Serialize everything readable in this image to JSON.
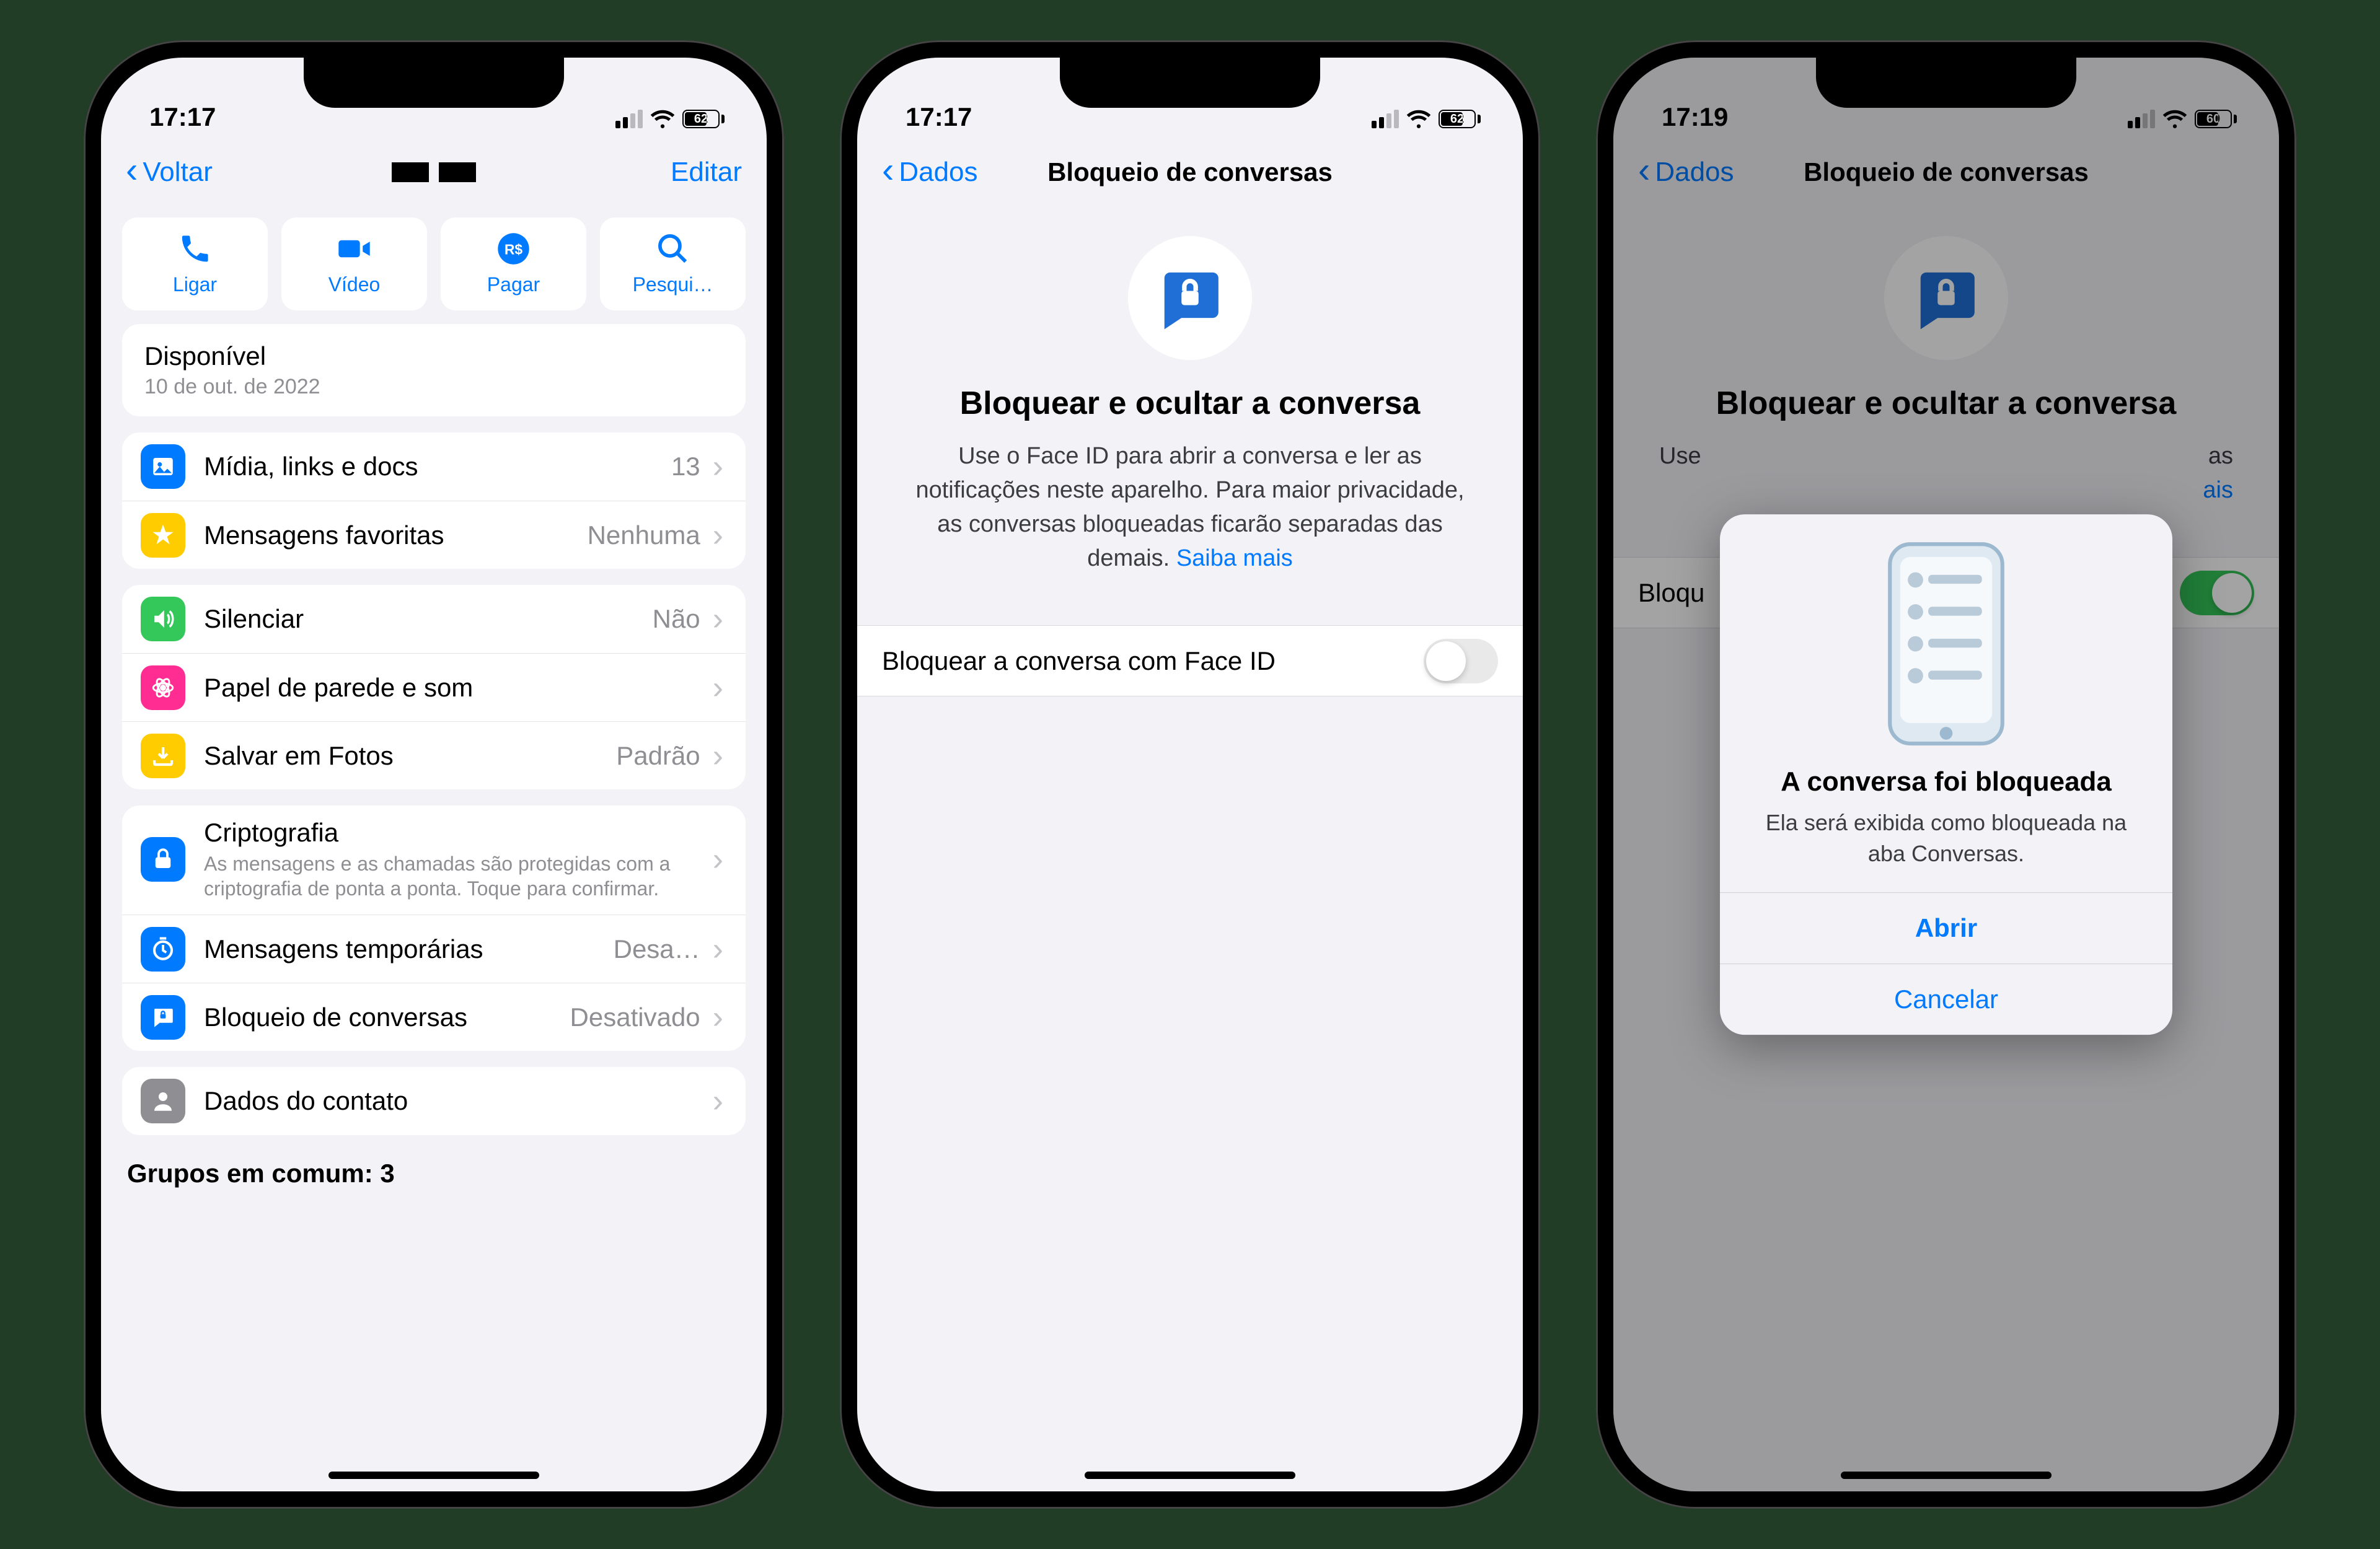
{
  "status": {
    "time1": "17:17",
    "time2": "17:17",
    "time3": "17:19",
    "battery1": "62",
    "battery2": "62",
    "battery3": "60"
  },
  "phone1": {
    "nav": {
      "back": "Voltar",
      "edit": "Editar"
    },
    "actions": {
      "call": "Ligar",
      "video": "Vídeo",
      "pay": "Pagar",
      "search": "Pesqui…"
    },
    "status_card": {
      "title": "Disponível",
      "date": "10 de out. de 2022"
    },
    "rows": {
      "media": "Mídia, links e docs",
      "media_v": "13",
      "fav": "Mensagens favoritas",
      "fav_v": "Nenhuma",
      "mute": "Silenciar",
      "mute_v": "Não",
      "wallpaper": "Papel de parede e som",
      "save": "Salvar em Fotos",
      "save_v": "Padrão",
      "crypto": "Criptografia",
      "crypto_sub": "As mensagens e as chamadas são protegidas com a criptografia de ponta a ponta. Toque para confirmar.",
      "disappearing": "Mensagens temporárias",
      "disappearing_v": "Desa…",
      "chatlock": "Bloqueio de conversas",
      "chatlock_v": "Desativado",
      "contact": "Dados do contato"
    },
    "groups": "Grupos em comum: 3"
  },
  "phone2": {
    "nav": {
      "back": "Dados",
      "title": "Bloqueio de conversas"
    },
    "hero": {
      "title": "Bloquear e ocultar a conversa",
      "body": "Use o Face ID para abrir a conversa e ler as notificações neste aparelho. Para maior privacidade, as conversas bloqueadas ficarão separadas das demais. ",
      "learn": "Saiba mais"
    },
    "setting": "Bloquear a conversa com Face ID"
  },
  "phone3": {
    "nav": {
      "back": "Dados",
      "title": "Bloqueio de conversas"
    },
    "hero": {
      "title": "Bloquear e ocultar a conversa",
      "body_prefix": "Use",
      "body_suffix": "as",
      "learn_suffix": "ais"
    },
    "setting_fragment": "Bloqu",
    "modal": {
      "title": "A conversa foi bloqueada",
      "body": "Ela será exibida como bloqueada na aba Conversas.",
      "open": "Abrir",
      "cancel": "Cancelar"
    }
  }
}
